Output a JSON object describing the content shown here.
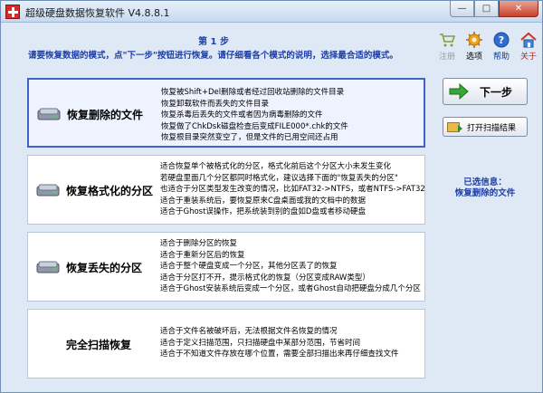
{
  "window": {
    "title": "超级硬盘数据恢复软件 V4.8.8.1",
    "min_glyph": "—",
    "max_glyph": "□",
    "close_glyph": "✕"
  },
  "header": {
    "step": "第 1 步",
    "instruction": "请要恢复数据的模式，点\"下一步\"按钮进行恢复。请仔细看各个模式的说明，选择最合适的模式。"
  },
  "toolbar": [
    {
      "label": "注册",
      "icon": "cart-icon",
      "state": "disabled"
    },
    {
      "label": "选项",
      "icon": "gear-icon",
      "state": "normal"
    },
    {
      "label": "帮助",
      "icon": "help-icon",
      "state": "link"
    },
    {
      "label": "关于",
      "icon": "home-icon",
      "state": "red"
    }
  ],
  "options": [
    {
      "title": "恢复删除的文件",
      "icon": "disk-icon",
      "selected": true,
      "lines": [
        "恢复被Shift+Del删除或者经过回收站删除的文件目录",
        "恢复卸载软件而丢失的文件目录",
        "恢复杀毒后丢失的文件或者因为病毒删除的文件",
        "恢复做了ChkDsk磁盘检查后变成FILE000*.chk的文件",
        "恢复根目录突然变空了，但是文件的已用空间还占用"
      ]
    },
    {
      "title": "恢复格式化的分区",
      "icon": "disk-icon",
      "selected": false,
      "lines": [
        "适合恢复单个被格式化的分区，格式化前后这个分区大小未发生变化",
        "若硬盘里面几个分区都同时格式化，建议选择下面的\"恢复丢失的分区\"",
        "也适合于分区类型发生改变的情况，比如FAT32->NTFS，或者NTFS->FAT32",
        "适合于重装系统后，要恢复原来C盘桌面或我的文档中的数据",
        "适合于Ghost误操作，把系统装到别的盘如D盘或者移动硬盘"
      ]
    },
    {
      "title": "恢复丢失的分区",
      "icon": "disk-icon",
      "selected": false,
      "lines": [
        "适合于删除分区的恢复",
        "适合于重新分区后的恢复",
        "适合于整个硬盘变成一个分区，其他分区丢了的恢复",
        "适合于分区打不开，提示格式化的恢复（分区变成RAW类型）",
        "适合于Ghost安装系统后变成一个分区，或者Ghost自动把硬盘分成几个分区"
      ]
    },
    {
      "title": "完全扫描恢复",
      "icon": "",
      "selected": false,
      "lines": [
        "适合于文件名被破坏后，无法根据文件名恢复的情况",
        "适合于定义扫描范围，只扫描硬盘中某部分范围，节省时间",
        "适合于不知道文件存放在哪个位置，需要全部扫描出来再仔细查找文件"
      ]
    }
  ],
  "right_panel": {
    "next_label": "下一步",
    "open_scan_label": "打开扫描结果",
    "selected_heading": "已选信息：",
    "selected_value": "恢复删除的文件"
  },
  "colors": {
    "accent": "#1d3fa8",
    "selection_border": "#4063c9",
    "window_bg": "#dfe9f5"
  }
}
